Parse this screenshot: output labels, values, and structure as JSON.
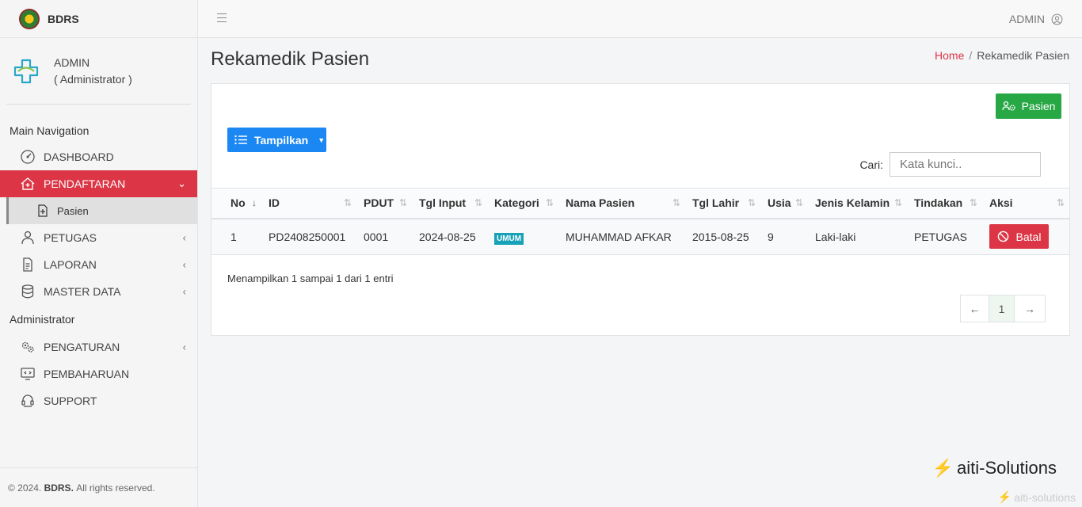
{
  "brand": {
    "name": "BDRS"
  },
  "user": {
    "name": "ADMIN",
    "role": "( Administrator )"
  },
  "nav": {
    "main_header": "Main Navigation",
    "items": [
      {
        "label": "DASHBOARD"
      },
      {
        "label": "PENDAFTARAN"
      },
      {
        "label": "PETUGAS"
      },
      {
        "label": "LAPORAN"
      },
      {
        "label": "MASTER DATA"
      }
    ],
    "sub_items": [
      {
        "label": "Pasien"
      }
    ],
    "admin_header": "Administrator",
    "admin_items": [
      {
        "label": "PENGATURAN"
      },
      {
        "label": "PEMBAHARUAN"
      },
      {
        "label": "SUPPORT"
      }
    ]
  },
  "footer": {
    "prefix": "© 2024.",
    "brand": "BDRS.",
    "suffix": "All rights reserved."
  },
  "topbar": {
    "user": "ADMIN"
  },
  "page": {
    "title": "Rekamedik Pasien",
    "breadcrumb_home": "Home",
    "breadcrumb_sep": "/",
    "breadcrumb_current": "Rekamedik Pasien"
  },
  "buttons": {
    "pasien": "Pasien",
    "tampilkan": "Tampilkan",
    "batal": "Batal"
  },
  "search": {
    "label": "Cari:",
    "placeholder": "Kata kunci.."
  },
  "table": {
    "headers": [
      "No",
      "ID",
      "PDUT",
      "Tgl Input",
      "Kategori",
      "Nama Pasien",
      "Tgl Lahir",
      "Usia",
      "Jenis Kelamin",
      "Tindakan",
      "Aksi"
    ],
    "rows": [
      {
        "no": "1",
        "id": "PD2408250001",
        "pdut": "0001",
        "tgl_input": "2024-08-25",
        "kategori": "UMUM",
        "nama": "MUHAMMAD AFKAR",
        "tgl_lahir": "2015-08-25",
        "usia": "9",
        "jk": "Laki-laki",
        "tindakan": "PETUGAS"
      }
    ]
  },
  "info": "Menampilkan 1 sampai 1 dari 1 entri",
  "pager": {
    "prev": "←",
    "current": "1",
    "next": "→"
  },
  "watermark": {
    "text": "aiti-Solutions",
    "small": "aiti-solutions"
  },
  "colors": {
    "danger": "#dc3545",
    "success": "#28a745",
    "primary": "#1a87f2",
    "info": "#17a2b8"
  }
}
